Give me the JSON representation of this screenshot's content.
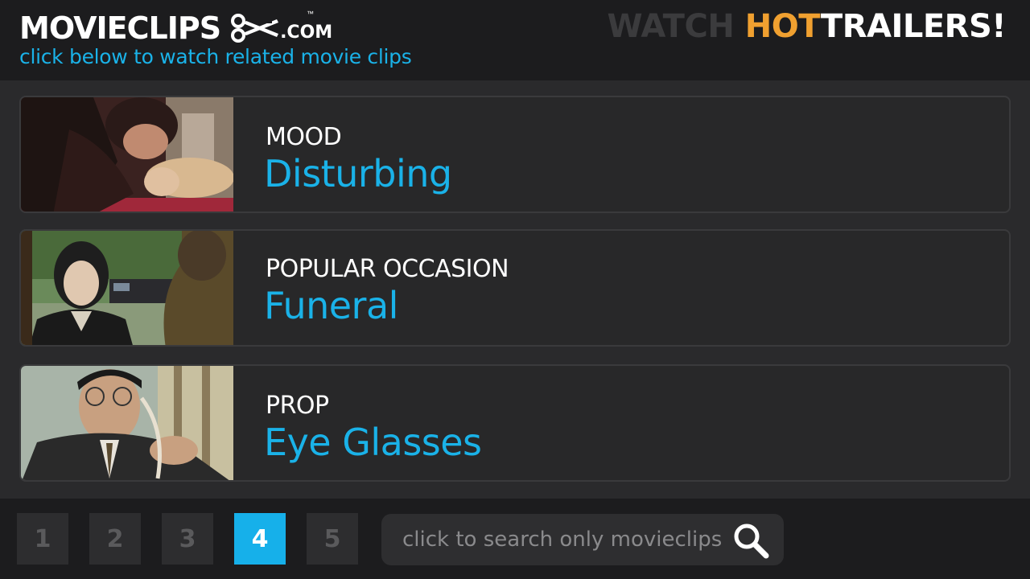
{
  "header": {
    "logo_text": "MOVIECLIPS",
    "logo_tm": "™",
    "logo_domain": ".COM",
    "subtitle": "click below to watch related movie clips",
    "promo": {
      "part1": "WATCH ",
      "part2": "HOT",
      "part3": "TRAILERS!"
    }
  },
  "cards": [
    {
      "label": "MOOD",
      "value": "Disturbing",
      "thumb_icon": "movie-still-bedroom-scene"
    },
    {
      "label": "POPULAR OCCASION",
      "value": "Funeral",
      "thumb_icon": "movie-still-funeral-scene"
    },
    {
      "label": "PROP",
      "value": "Eye Glasses",
      "thumb_icon": "movie-still-man-on-phone"
    }
  ],
  "pagination": {
    "pages": [
      "1",
      "2",
      "3",
      "4",
      "5"
    ],
    "active": "4"
  },
  "search": {
    "placeholder": "click to search only movieclips",
    "icon": "search-icon"
  },
  "colors": {
    "accent": "#1ab2e8",
    "hot": "#f0a030",
    "background": "#222224"
  }
}
